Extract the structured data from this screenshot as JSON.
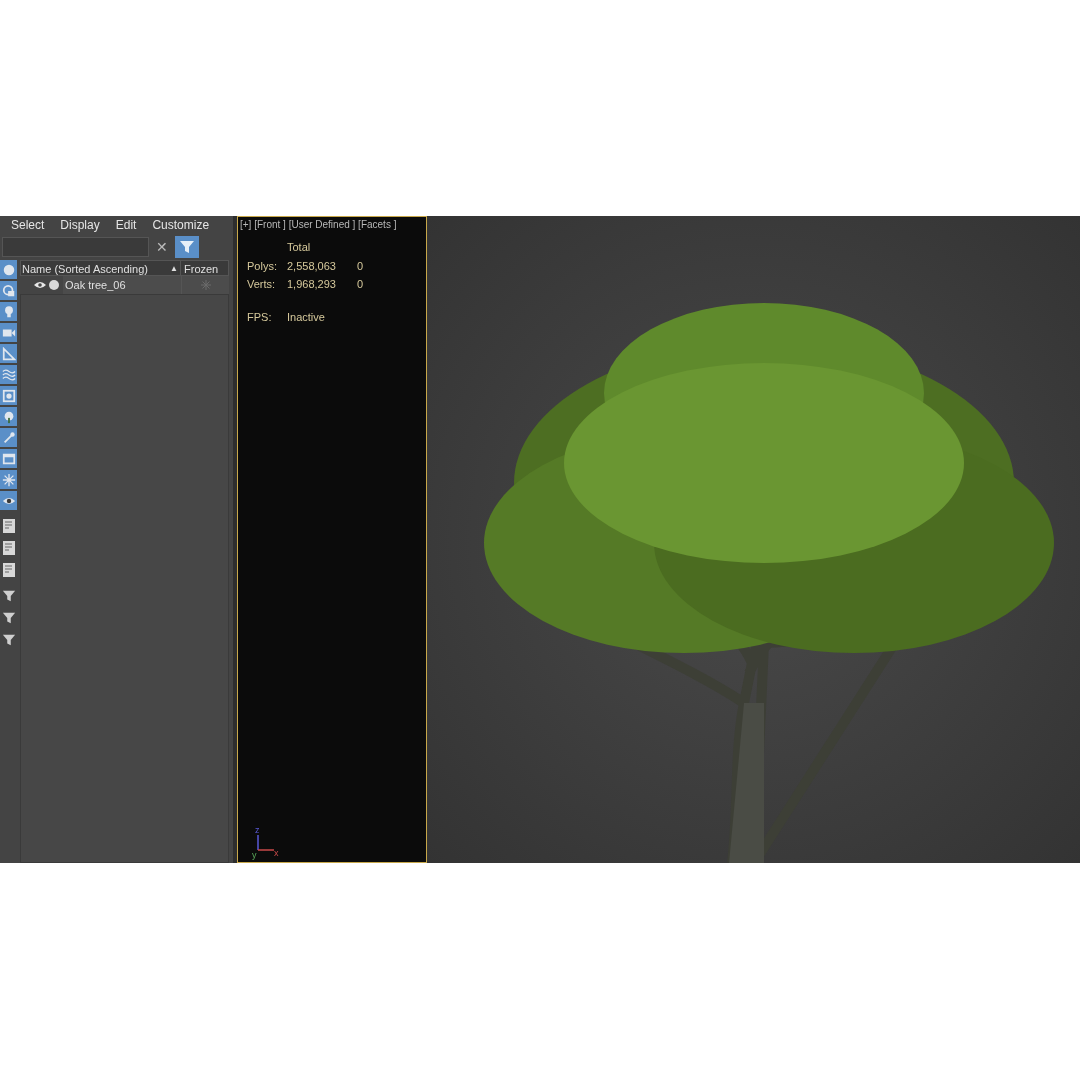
{
  "menu": [
    "Select",
    "Display",
    "Edit",
    "Customize"
  ],
  "search": {
    "clear": "✕"
  },
  "columns": [
    {
      "label": "Name (Sorted Ascending)",
      "sort": "▲"
    },
    {
      "label": "Frozen"
    }
  ],
  "rows": [
    {
      "name": "Oak tree_06",
      "visible": true,
      "frozen": false
    }
  ],
  "toolbar": [
    {
      "kind": "toggle",
      "on": true
    },
    {
      "kind": "toggle",
      "on": true
    },
    {
      "kind": "toggle",
      "on": true
    },
    {
      "kind": "toggle",
      "on": true
    },
    {
      "kind": "toggle",
      "on": true
    },
    {
      "kind": "toggle",
      "on": true
    },
    {
      "kind": "toggle",
      "on": true
    },
    {
      "kind": "toggle",
      "on": true
    },
    {
      "kind": "toggle",
      "on": true
    },
    {
      "kind": "toggle",
      "on": true
    },
    {
      "kind": "toggle",
      "on": true
    },
    {
      "kind": "toggle",
      "on": true
    },
    {
      "kind": "action"
    },
    {
      "kind": "action"
    },
    {
      "kind": "action"
    },
    {
      "kind": "filter"
    },
    {
      "kind": "filter"
    },
    {
      "kind": "filter"
    }
  ],
  "viewport_label": "[+] [Front ] [User Defined ] [Facets ]",
  "stats": {
    "header": "Total",
    "rows": [
      {
        "label": "Polys:",
        "total": "2,558,063",
        "selected": "0"
      },
      {
        "label": "Verts:",
        "total": "1,968,293",
        "selected": "0"
      }
    ],
    "fps_label": "FPS:",
    "fps": "Inactive"
  },
  "axes": [
    "z",
    "y",
    "x"
  ]
}
